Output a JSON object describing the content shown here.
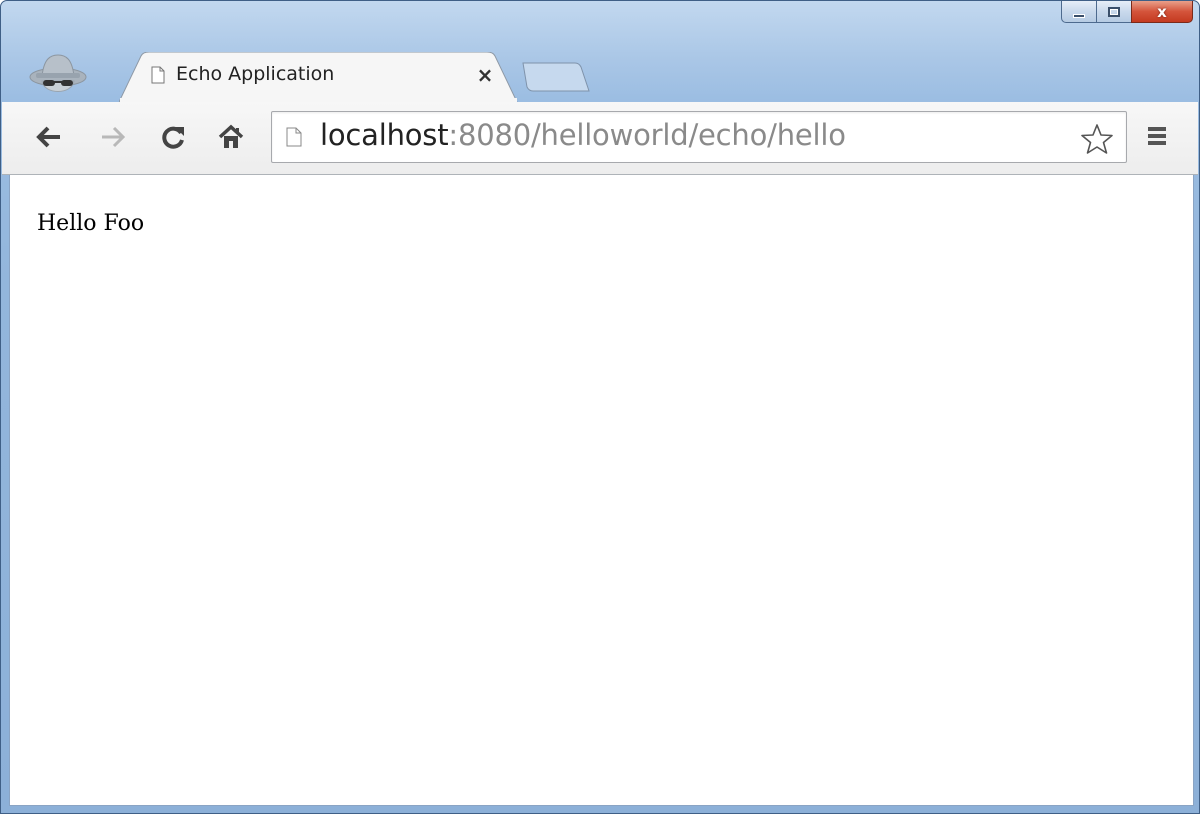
{
  "window": {
    "caption_buttons": [
      "minimize-icon",
      "maximize-icon",
      "close-icon"
    ],
    "close_glyph": "x"
  },
  "tabs": [
    {
      "title": "Echo Application",
      "active": true,
      "close_glyph": "×"
    }
  ],
  "toolbar": {
    "back": "arrow-left-icon",
    "forward": "arrow-right-icon",
    "reload": "reload-icon",
    "home": "home-icon",
    "bookmark": "star-icon",
    "menu": "menu-icon"
  },
  "omnibox": {
    "host": "localhost",
    "rest": ":8080/helloworld/echo/hello"
  },
  "page": {
    "text": "Hello Foo"
  },
  "colors": {
    "frame": "#a9c6e6",
    "url_host": "#222222",
    "url_path": "#8a8a8a",
    "close_button": "#d4543b"
  }
}
